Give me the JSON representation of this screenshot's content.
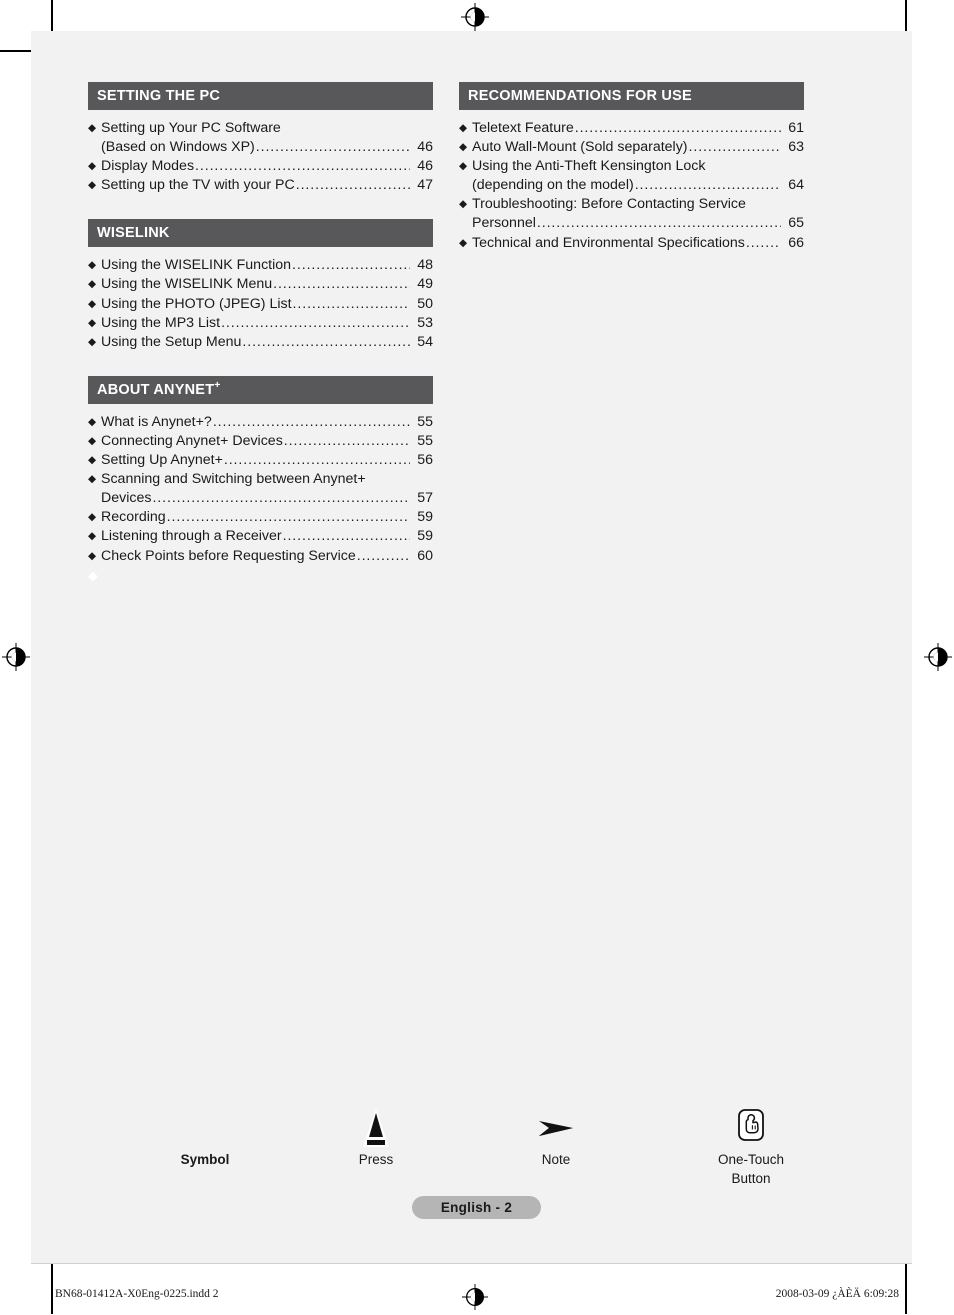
{
  "document": {
    "page_badge": "English - 2"
  },
  "sections": [
    {
      "id": "setting-the-pc",
      "title": "SETTING THE PC",
      "superscript": "",
      "column": "left",
      "items": [
        {
          "label": "Setting up Your PC Software",
          "cont": "(Based on Windows XP)",
          "page": "46"
        },
        {
          "label": "Display Modes",
          "cont": "",
          "page": "46"
        },
        {
          "label": "Setting up the TV with your PC",
          "cont": "",
          "page": "47"
        }
      ]
    },
    {
      "id": "wiselink",
      "title": "WISELINK",
      "superscript": "",
      "column": "left",
      "items": [
        {
          "label": "Using the WISELINK Function",
          "cont": "",
          "page": "48"
        },
        {
          "label": "Using the WISELINK Menu",
          "cont": "",
          "page": "49"
        },
        {
          "label": "Using the PHOTO (JPEG) List",
          "cont": "",
          "page": "50"
        },
        {
          "label": "Using the MP3 List",
          "cont": "",
          "page": "53"
        },
        {
          "label": "Using the Setup Menu",
          "cont": "",
          "page": "54"
        }
      ]
    },
    {
      "id": "about-anynet",
      "title": "ABOUT ANYNET",
      "superscript": "+",
      "column": "left",
      "items": [
        {
          "label": "What is Anynet+?",
          "cont": "",
          "page": "55"
        },
        {
          "label": "Connecting Anynet+ Devices",
          "cont": "",
          "page": "55"
        },
        {
          "label": "Setting Up Anynet+",
          "cont": "",
          "page": "56"
        },
        {
          "label": "Scanning and Switching between Anynet+",
          "cont": "Devices",
          "page": "57"
        },
        {
          "label": "Recording",
          "cont": "",
          "page": "59"
        },
        {
          "label": "Listening through a Receiver",
          "cont": "",
          "page": "59"
        },
        {
          "label": "Check Points before Requesting Service",
          "cont": "",
          "page": "60"
        }
      ]
    },
    {
      "id": "recommendations-for-use",
      "title": "RECOMMENDATIONS FOR USE",
      "superscript": "",
      "column": "right",
      "items": [
        {
          "label": "Teletext Feature",
          "cont": "",
          "page": "61"
        },
        {
          "label": "Auto Wall-Mount (Sold separately)",
          "cont": "",
          "page": "63"
        },
        {
          "label": "Using the Anti-Theft Kensington Lock",
          "cont": "(depending on the model)",
          "page": "64"
        },
        {
          "label": "Troubleshooting: Before Contacting Service",
          "cont": "Personnel",
          "page": "65"
        },
        {
          "label": "Technical and Environmental Specifications",
          "cont": "",
          "page": "66"
        }
      ]
    }
  ],
  "legend": {
    "title": "Symbol",
    "entries": [
      {
        "icon": "press-triangle-icon",
        "caption": "Press"
      },
      {
        "icon": "note-arrow-icon",
        "caption": "Note"
      },
      {
        "icon": "one-touch-button-icon",
        "caption_line1": "One-Touch",
        "caption_line2": "Button"
      }
    ]
  },
  "footer": {
    "filename": "BN68-01412A-X0Eng-0225.indd   2",
    "timestamp": "2008-03-09   ¿ÀÈÄ 6:09:28"
  },
  "colors": {
    "section_bar": "#58585a",
    "page_background": "#f2f2f2",
    "badge": "#b5b5b5",
    "text": "#1a1a1a"
  }
}
